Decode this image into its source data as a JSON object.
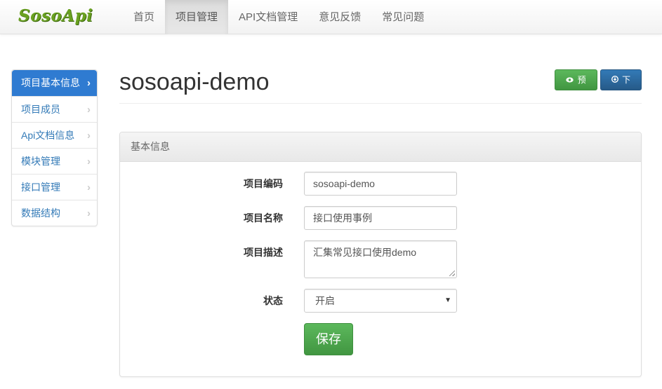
{
  "brand": "SosoApi",
  "nav": [
    "首页",
    "项目管理",
    "API文档管理",
    "意见反馈",
    "常见问题"
  ],
  "nav_active": 1,
  "sidebar": {
    "items": [
      {
        "label": "项目基本信息"
      },
      {
        "label": "项目成员"
      },
      {
        "label": "Api文档信息"
      },
      {
        "label": "模块管理"
      },
      {
        "label": "接口管理"
      },
      {
        "label": "数据结构"
      }
    ],
    "active": 0,
    "chevron": "›"
  },
  "title": "sosoapi-demo",
  "actions": {
    "preview_label": "预览",
    "preview_icon": "eye-icon",
    "download_label": "下载",
    "download_icon": "download-icon"
  },
  "panel": {
    "heading": "基本信息",
    "code_label": "项目编码",
    "code_value": "sosoapi-demo",
    "name_label": "项目名称",
    "name_value": "接口使用事例",
    "desc_label": "项目描述",
    "desc_value": "汇集常见接口使用demo",
    "status_label": "状态",
    "status_value": "开启",
    "save_label": "保存"
  },
  "colors": {
    "brand": "#6aa121",
    "primary": "#2f7bd1",
    "success": "#5cb85c"
  }
}
